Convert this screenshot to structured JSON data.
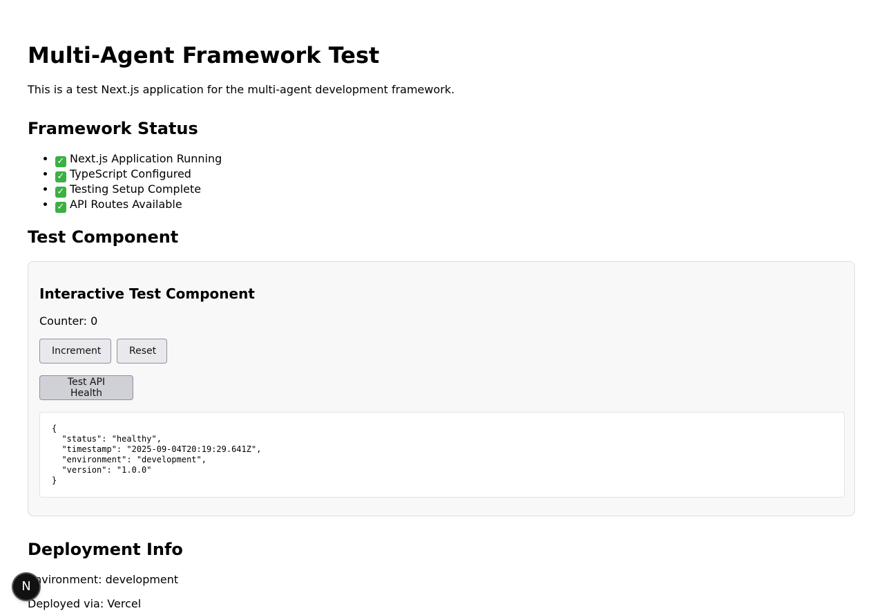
{
  "header": {
    "title": "Multi-Agent Framework Test",
    "intro": "This is a test Next.js application for the multi-agent development framework."
  },
  "status": {
    "heading": "Framework Status",
    "check_icon": "check-mark-icon",
    "check_color": "#3cb043",
    "items": [
      "Next.js Application Running",
      "TypeScript Configured",
      "Testing Setup Complete",
      "API Routes Available"
    ]
  },
  "component": {
    "heading": "Test Component",
    "card_title": "Interactive Test Component",
    "counter_label": "Counter: 0",
    "increment_label": "Increment",
    "reset_label": "Reset",
    "health_label": "Test API Health",
    "response": "{\n  \"status\": \"healthy\",\n  \"timestamp\": \"2025-09-04T20:19:29.641Z\",\n  \"environment\": \"development\",\n  \"version\": \"1.0.0\"\n}"
  },
  "deployment": {
    "heading": "Deployment Info",
    "environment": "Environment: development",
    "deployed_via": "Deployed via: Vercel"
  },
  "dev_badge": {
    "icon": "nextjs-logo-icon",
    "glyph": "N"
  }
}
